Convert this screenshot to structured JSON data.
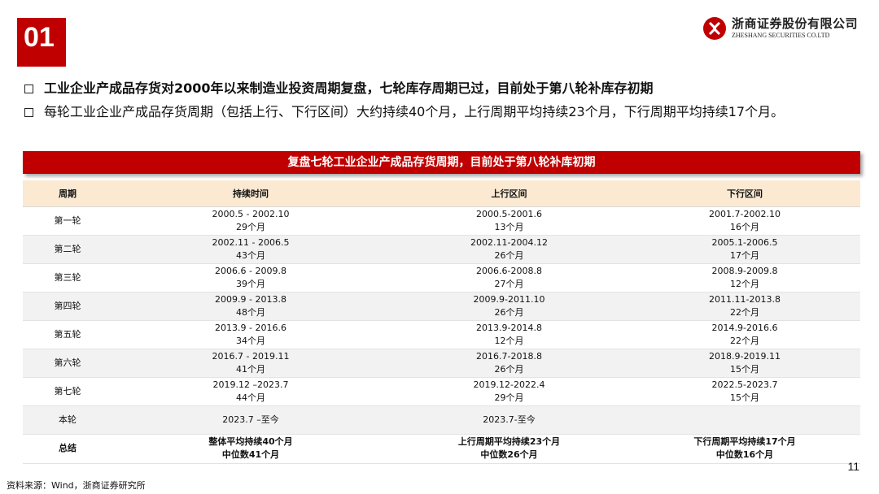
{
  "header": {
    "section_number": "01",
    "logo_cn": "浙商证券股份有限公司",
    "logo_en": "ZHESHANG SECURITIES CO.LTD",
    "brand_color": "#c00000"
  },
  "bullets": [
    "工业企业产成品存货对2000年以来制造业投资周期复盘，七轮库存周期已过，目前处于第八轮补库存初期",
    "每轮工业企业产成品存货周期（包括上行、下行区间）大约持续40个月，上行周期平均持续23个月，下行周期平均持续17个月。"
  ],
  "table": {
    "title": "复盘七轮工业企业产成品存货周期，目前处于第八轮补库初期",
    "headers": [
      "周期",
      "持续时间",
      "上行区间",
      "下行区间"
    ],
    "rows": [
      {
        "name": "第一轮",
        "dur": "2000.5 - 2002.10",
        "dur_m": "29个月",
        "up": "2000.5-2001.6",
        "up_m": "13个月",
        "down": "2001.7-2002.10",
        "down_m": "16个月"
      },
      {
        "name": "第二轮",
        "dur": "2002.11 - 2006.5",
        "dur_m": "43个月",
        "up": "2002.11-2004.12",
        "up_m": "26个月",
        "down": "2005.1-2006.5",
        "down_m": "17个月"
      },
      {
        "name": "第三轮",
        "dur": "2006.6 - 2009.8",
        "dur_m": "39个月",
        "up": "2006.6-2008.8",
        "up_m": "27个月",
        "down": "2008.9-2009.8",
        "down_m": "12个月"
      },
      {
        "name": "第四轮",
        "dur": "2009.9 - 2013.8",
        "dur_m": "48个月",
        "up": "2009.9-2011.10",
        "up_m": "26个月",
        "down": "2011.11-2013.8",
        "down_m": "22个月"
      },
      {
        "name": "第五轮",
        "dur": "2013.9 - 2016.6",
        "dur_m": "34个月",
        "up": "2013.9-2014.8",
        "up_m": "12个月",
        "down": "2014.9-2016.6",
        "down_m": "22个月"
      },
      {
        "name": "第六轮",
        "dur": "2016.7 - 2019.11",
        "dur_m": "41个月",
        "up": "2016.7-2018.8",
        "up_m": "26个月",
        "down": "2018.9-2019.11",
        "down_m": "15个月"
      },
      {
        "name": "第七轮",
        "dur": "2019.12 –2023.7",
        "dur_m": "44个月",
        "up": "2019.12-2022.4",
        "up_m": "29个月",
        "down": "2022.5-2023.7",
        "down_m": "15个月"
      },
      {
        "name": "本轮",
        "dur": "2023.7 –至今",
        "dur_m": "",
        "up": "2023.7-至今",
        "up_m": "",
        "down": "",
        "down_m": ""
      }
    ],
    "summary": {
      "name": "总结",
      "dur": "整体平均持续40个月",
      "dur_m": "中位数41个月",
      "up": "上行周期平均持续23个月",
      "up_m": "中位数26个月",
      "down": "下行周期平均持续17个月",
      "down_m": "中位数16个月"
    }
  },
  "footer": {
    "page_number": "11",
    "source": "资料来源：Wind，浙商证券研究所"
  }
}
